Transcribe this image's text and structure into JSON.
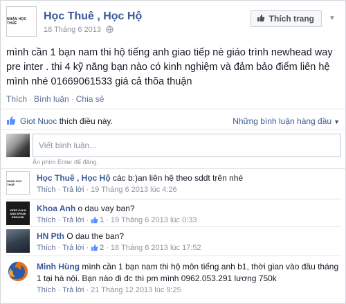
{
  "post": {
    "page_avatar_text": "NHẬN HỌC THUÊ",
    "page_name": "Học Thuê , Học Hộ",
    "date": "18 Tháng 6 2013",
    "like_page_label": "Thích trang",
    "text": "mình cần 1 bạn nam thi hộ tiếng anh giao tiếp nè giáo trình newhead way pre inter . thi 4 kỹ năng bạn nào có kinh nghiệm và đảm bảo điểm liên hệ mình nhé 01669061533 giá cả thõa thuận",
    "actions": {
      "like": "Thích",
      "comment": "Bình luận",
      "share": "Chia sẻ"
    }
  },
  "likes": {
    "name": "Giot Nuoc",
    "suffix": " thích điều này.",
    "sort_label": "Những bình luận hàng đầu"
  },
  "composer": {
    "placeholder": "Viết bình luận...",
    "hint": "Ấn phím Enter để đăng."
  },
  "comments": [
    {
      "author": "Học Thuê , Học Hộ",
      "text": " các b:)an liên hệ theo sddt trên nhé",
      "like": "Thích",
      "reply": "Trả lời",
      "likes_count": "",
      "time": "19 Tháng 6 2013 lúc 4:26"
    },
    {
      "author": "Khoa Anh",
      "text": " o dau vay ban?",
      "like": "Thích",
      "reply": "Trả lời",
      "likes_count": "1",
      "time": "19 Tháng 6 2013 lúc 0:33"
    },
    {
      "author": "HN Pth",
      "text": " O dau the ban?",
      "like": "Thích",
      "reply": "Trả lời",
      "likes_count": "2",
      "time": "18 Tháng 6 2013 lúc 17:52"
    },
    {
      "author": "Minh Hùng",
      "text": " mình cần 1 bạn nam thi hộ môn tiếng anh b1, thời gian vào đầu tháng 1 tại hà nội. Bạn nào đi đc thì pm mình 0962.053.291 lương 750k",
      "like": "Thích",
      "reply": "Trả lời",
      "likes_count": "",
      "time": "21 Tháng 12 2013 lúc 9:25"
    }
  ],
  "avatar_texts": {
    "keep_calm": "KEEP CALM AND SPEAK ENGLISH"
  },
  "colors": {
    "link": "#3b5998",
    "meta": "#90949c",
    "action": "#5f6f94"
  }
}
